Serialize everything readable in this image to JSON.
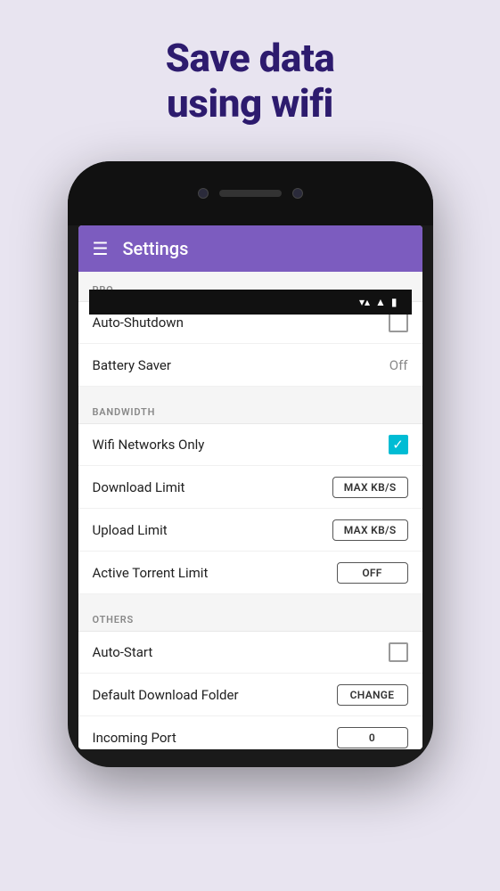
{
  "headline": {
    "line1": "Save data",
    "line2": "using wifi"
  },
  "appBar": {
    "title": "Settings"
  },
  "sections": [
    {
      "id": "pro",
      "header": "PRO",
      "items": [
        {
          "id": "auto-shutdown",
          "label": "Auto-Shutdown",
          "control": "checkbox",
          "value": false
        },
        {
          "id": "battery-saver",
          "label": "Battery Saver",
          "control": "text",
          "value": "Off"
        }
      ]
    },
    {
      "id": "bandwidth",
      "header": "BANDWIDTH",
      "items": [
        {
          "id": "wifi-networks-only",
          "label": "Wifi Networks Only",
          "control": "checkbox",
          "value": true
        },
        {
          "id": "download-limit",
          "label": "Download Limit",
          "control": "button",
          "value": "MAX KB/S"
        },
        {
          "id": "upload-limit",
          "label": "Upload Limit",
          "control": "button",
          "value": "MAX KB/S"
        },
        {
          "id": "active-torrent-limit",
          "label": "Active Torrent Limit",
          "control": "button",
          "value": "OFF"
        }
      ]
    },
    {
      "id": "others",
      "header": "OTHERS",
      "items": [
        {
          "id": "auto-start",
          "label": "Auto-Start",
          "control": "checkbox",
          "value": false
        },
        {
          "id": "default-download-folder",
          "label": "Default Download Folder",
          "control": "button",
          "value": "CHANGE"
        },
        {
          "id": "incoming-port",
          "label": "Incoming Port",
          "control": "button",
          "value": "0"
        }
      ]
    }
  ],
  "statusBar": {
    "wifi": "▲",
    "signal": "▲",
    "battery": "▮"
  }
}
